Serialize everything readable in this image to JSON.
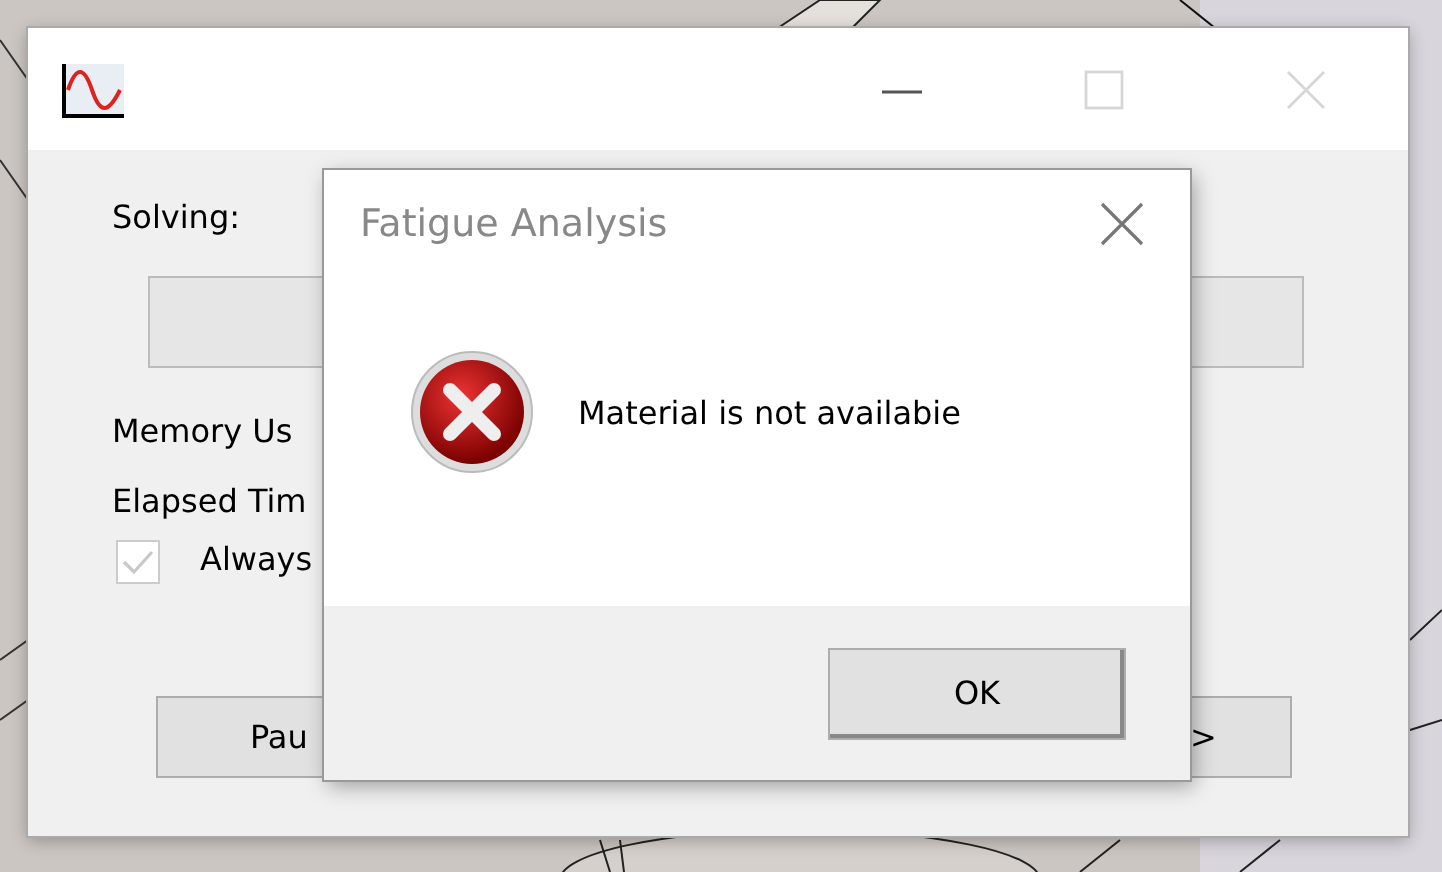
{
  "main_window": {
    "controls": [
      {
        "kind": "minimize",
        "disabled": false
      },
      {
        "kind": "maximize",
        "disabled": true
      },
      {
        "kind": "close",
        "disabled": true
      }
    ],
    "solving_label": "Solving:",
    "progress": {
      "level": 0
    },
    "memory_label": "Memory Us",
    "elapsed_label": "Elapsed Tim",
    "always_option": {
      "label": "Always",
      "checked": true,
      "disabled": true
    },
    "buttons": [
      {
        "label": "Pau"
      },
      {
        "label": ">"
      }
    ]
  },
  "dialog": {
    "title": "Fatigue Analysis",
    "message": "Material is not availabie",
    "buttons": [
      {
        "label": "OK"
      }
    ]
  }
}
